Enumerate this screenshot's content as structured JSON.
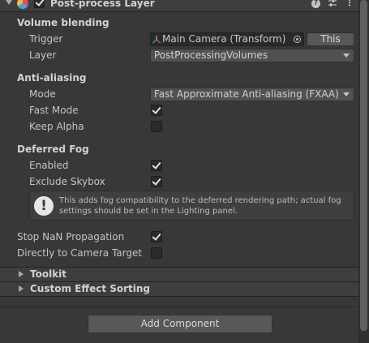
{
  "header": {
    "title": "Post-process Layer",
    "enabled": true,
    "icons": [
      "fold-arrow-icon",
      "component-icon",
      "help-icon",
      "settings-sliders-icon",
      "more-menu-icon"
    ]
  },
  "volume_blending": {
    "title": "Volume blending",
    "trigger_label": "Trigger",
    "trigger_value": "Main Camera (Transform)",
    "this_button": "This",
    "layer_label": "Layer",
    "layer_value": "PostProcessingVolumes"
  },
  "anti_aliasing": {
    "title": "Anti-aliasing",
    "mode_label": "Mode",
    "mode_value": "Fast Approximate Anti-aliasing (FXAA)",
    "fast_mode_label": "Fast Mode",
    "fast_mode": true,
    "keep_alpha_label": "Keep Alpha",
    "keep_alpha": false
  },
  "deferred_fog": {
    "title": "Deferred Fog",
    "enabled_label": "Enabled",
    "enabled": true,
    "exclude_skybox_label": "Exclude Skybox",
    "exclude_skybox": true,
    "help_line1": "This adds fog compatibility to the deferred rendering path; actual fog",
    "help_line2": "settings should be set in the Lighting panel."
  },
  "misc": {
    "stop_nan_label": "Stop NaN Propagation",
    "stop_nan": true,
    "direct_camera_label": "Directly to Camera Target",
    "direct_camera": false
  },
  "foldouts": {
    "toolkit": "Toolkit",
    "custom_sorting": "Custom Effect Sorting"
  },
  "add_component": "Add Component"
}
